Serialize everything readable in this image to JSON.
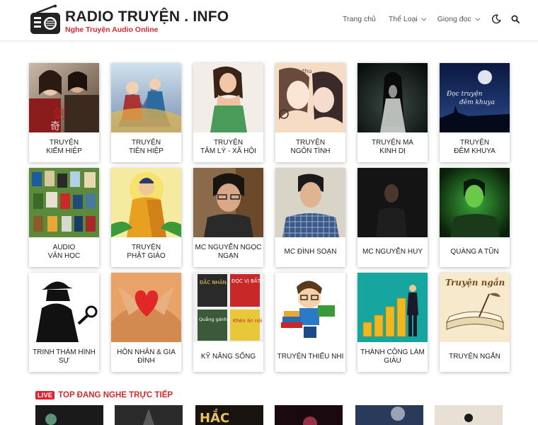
{
  "header": {
    "logo_title": "RADIO TRUYỆN . INFO",
    "logo_subtitle": "Nghe Truyện Audio Online",
    "nav": {
      "home": "Trang chủ",
      "genres": "Thể Loại",
      "voices": "Giọng đọc"
    }
  },
  "categories": [
    {
      "label": "Truyện\nKiếm Hiệp"
    },
    {
      "label": "Truyện\nTiên Hiệp"
    },
    {
      "label": "Truyện\nTâm Lý - Xã Hội"
    },
    {
      "label": "Truyện\nNgôn Tình"
    },
    {
      "label": "Truyện Ma\nKinh Dị"
    },
    {
      "label": "Truyện\nĐêm Khuya"
    },
    {
      "label": "Audio\nVăn Học"
    },
    {
      "label": "Truyện\nPhật Giáo"
    },
    {
      "label": "MC Nguyễn Ngọc\nNgạn"
    },
    {
      "label": "MC Đình Soạn"
    },
    {
      "label": "MC Nguyễn Huy"
    },
    {
      "label": "Quàng A Tũn"
    },
    {
      "label": "Trinh Thám Hình\nSự"
    },
    {
      "label": "Hôn Nhân & Gia\nĐình"
    },
    {
      "label": "Kỹ Năng Sống"
    },
    {
      "label": "Truyện Thiếu Nhi"
    },
    {
      "label": "Thành Công Làm\nGiàu"
    },
    {
      "label": "Truyện Ngắn"
    }
  ],
  "thumb_text": {
    "dem_khuya": "Đọc truyện\nđêm khuya",
    "ngon_tinh": "thu",
    "truyen_ngan": "Truyện ngắn",
    "sach1": "ĐẮC NHÂN TÂM",
    "sach2": "ĐỌC VỊ BẤT KỲ AI",
    "sach3": "Quẳng gánh lo đi",
    "sach4": "Khéo ăn nói"
  },
  "live": {
    "badge": "LIVE",
    "title": "TOP ĐANG NGHE TRỰC TIẾP",
    "thumb3_text": "HẮC"
  },
  "colors": {
    "accent": "#d62b2b",
    "live_red": "#e5202e"
  }
}
